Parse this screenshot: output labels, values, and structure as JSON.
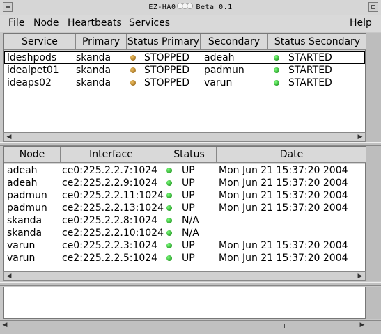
{
  "window": {
    "title_left": "EZ-HA0",
    "title_right": "Beta 0.1"
  },
  "menu": {
    "file": "File",
    "node": "Node",
    "heartbeats": "Heartbeats",
    "services": "Services",
    "help": "Help"
  },
  "services_table": {
    "headers": [
      "Service",
      "Primary",
      "Status Primary",
      "Secondary",
      "Status Secondary"
    ],
    "rows": [
      {
        "service": "ldeshpods",
        "primary": "skanda",
        "status_primary": "STOPPED",
        "secondary": "adeah",
        "status_secondary": "STARTED"
      },
      {
        "service": "idealpet01",
        "primary": "skanda",
        "status_primary": "STOPPED",
        "secondary": "padmun",
        "status_secondary": "STARTED"
      },
      {
        "service": "ideaps02",
        "primary": "skanda",
        "status_primary": "STOPPED",
        "secondary": "varun",
        "status_secondary": "STARTED"
      }
    ]
  },
  "nodes_table": {
    "headers": [
      "Node",
      "Interface",
      "Status",
      "Date"
    ],
    "rows": [
      {
        "node": "adeah",
        "interface": "ce0:225.2.2.7:1024",
        "status": "UP",
        "date": "Mon Jun 21 15:37:20 2004"
      },
      {
        "node": "adeah",
        "interface": "ce2:225.2.2.9:1024",
        "status": "UP",
        "date": "Mon Jun 21 15:37:20 2004"
      },
      {
        "node": "padmun",
        "interface": "ce0:225.2.2.11:1024",
        "status": "UP",
        "date": "Mon Jun 21 15:37:20 2004"
      },
      {
        "node": "padmun",
        "interface": "ce2:225.2.2.13:1024",
        "status": "UP",
        "date": "Mon Jun 21 15:37:20 2004"
      },
      {
        "node": "skanda",
        "interface": "ce0:225.2.2.8:1024",
        "status": "N/A",
        "date": ""
      },
      {
        "node": "skanda",
        "interface": "ce2:225.2.2.10:1024",
        "status": "N/A",
        "date": ""
      },
      {
        "node": "varun",
        "interface": "ce0:225.2.2.3:1024",
        "status": "UP",
        "date": "Mon Jun 21 15:37:20 2004"
      },
      {
        "node": "varun",
        "interface": "ce2:225.2.2.5:1024",
        "status": "UP",
        "date": "Mon Jun 21 15:37:20 2004"
      }
    ]
  },
  "colors": {
    "stopped": "#b07820",
    "started": "#18a018",
    "up": "#18a018"
  }
}
